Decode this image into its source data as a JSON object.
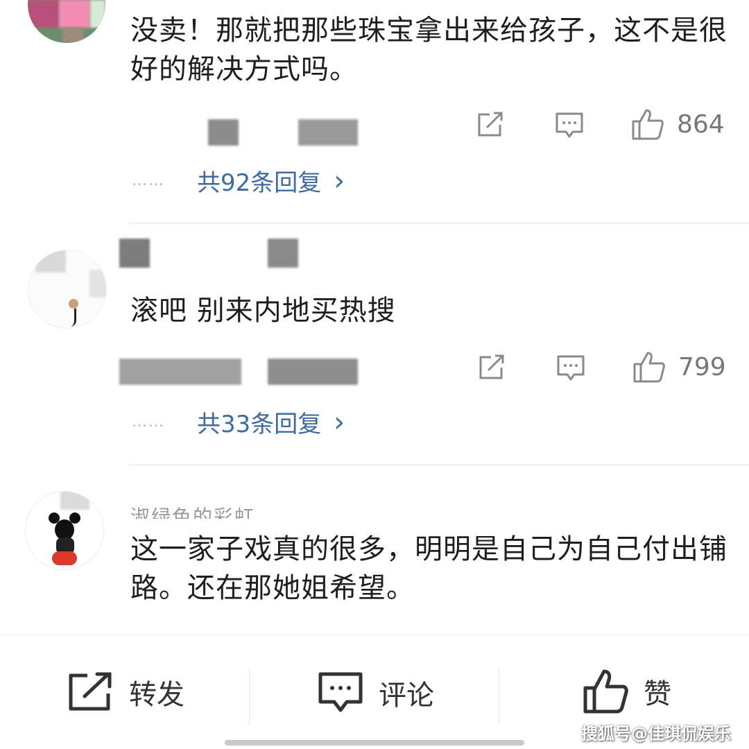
{
  "comments": [
    {
      "text": "没卖！那就把那些珠宝拿出来给孩子，这不是很好的解决方式吗。",
      "likes": "864",
      "replies": "共92条回复",
      "reply_chevron": "›",
      "reply_dots": "……"
    },
    {
      "text": "滚吧 别来内地买热搜",
      "likes": "799",
      "replies": "共33条回复",
      "reply_chevron": "›",
      "reply_dots": "……"
    },
    {
      "username": "淑绿色的彩虹",
      "text": "这一家子戏真的很多，明明是自己为自己付出铺路。还在那她姐希望。"
    }
  ],
  "bottom_bar": {
    "share_label": "转发",
    "comment_label": "评论",
    "like_label": "赞"
  },
  "watermark": "搜狐号@佳琪侃娱乐",
  "icons": {
    "share": "share-icon",
    "comment": "comment-icon",
    "like": "thumbs-up-icon"
  },
  "colors": {
    "reply_link": "#3d6aa0",
    "icon_gray": "#8a8a8a",
    "text": "#1e1e1e"
  }
}
